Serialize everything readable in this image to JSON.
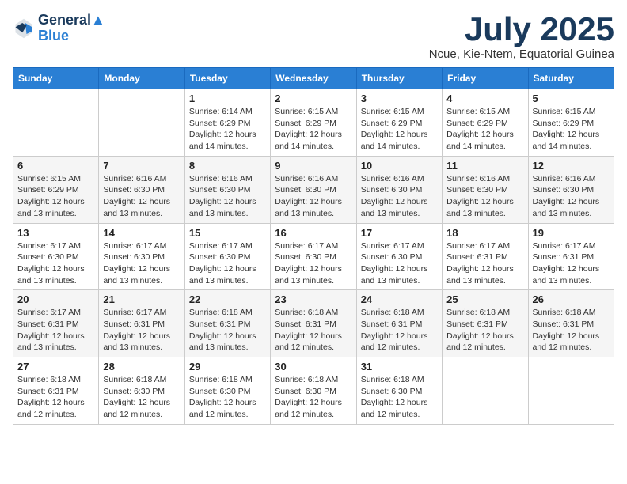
{
  "logo": {
    "line1": "General",
    "line2": "Blue"
  },
  "header": {
    "month": "July 2025",
    "location": "Ncue, Kie-Ntem, Equatorial Guinea"
  },
  "weekdays": [
    "Sunday",
    "Monday",
    "Tuesday",
    "Wednesday",
    "Thursday",
    "Friday",
    "Saturday"
  ],
  "weeks": [
    [
      {
        "day": "",
        "info": ""
      },
      {
        "day": "",
        "info": ""
      },
      {
        "day": "1",
        "info": "Sunrise: 6:14 AM\nSunset: 6:29 PM\nDaylight: 12 hours\nand 14 minutes."
      },
      {
        "day": "2",
        "info": "Sunrise: 6:15 AM\nSunset: 6:29 PM\nDaylight: 12 hours\nand 14 minutes."
      },
      {
        "day": "3",
        "info": "Sunrise: 6:15 AM\nSunset: 6:29 PM\nDaylight: 12 hours\nand 14 minutes."
      },
      {
        "day": "4",
        "info": "Sunrise: 6:15 AM\nSunset: 6:29 PM\nDaylight: 12 hours\nand 14 minutes."
      },
      {
        "day": "5",
        "info": "Sunrise: 6:15 AM\nSunset: 6:29 PM\nDaylight: 12 hours\nand 14 minutes."
      }
    ],
    [
      {
        "day": "6",
        "info": "Sunrise: 6:15 AM\nSunset: 6:29 PM\nDaylight: 12 hours\nand 13 minutes."
      },
      {
        "day": "7",
        "info": "Sunrise: 6:16 AM\nSunset: 6:30 PM\nDaylight: 12 hours\nand 13 minutes."
      },
      {
        "day": "8",
        "info": "Sunrise: 6:16 AM\nSunset: 6:30 PM\nDaylight: 12 hours\nand 13 minutes."
      },
      {
        "day": "9",
        "info": "Sunrise: 6:16 AM\nSunset: 6:30 PM\nDaylight: 12 hours\nand 13 minutes."
      },
      {
        "day": "10",
        "info": "Sunrise: 6:16 AM\nSunset: 6:30 PM\nDaylight: 12 hours\nand 13 minutes."
      },
      {
        "day": "11",
        "info": "Sunrise: 6:16 AM\nSunset: 6:30 PM\nDaylight: 12 hours\nand 13 minutes."
      },
      {
        "day": "12",
        "info": "Sunrise: 6:16 AM\nSunset: 6:30 PM\nDaylight: 12 hours\nand 13 minutes."
      }
    ],
    [
      {
        "day": "13",
        "info": "Sunrise: 6:17 AM\nSunset: 6:30 PM\nDaylight: 12 hours\nand 13 minutes."
      },
      {
        "day": "14",
        "info": "Sunrise: 6:17 AM\nSunset: 6:30 PM\nDaylight: 12 hours\nand 13 minutes."
      },
      {
        "day": "15",
        "info": "Sunrise: 6:17 AM\nSunset: 6:30 PM\nDaylight: 12 hours\nand 13 minutes."
      },
      {
        "day": "16",
        "info": "Sunrise: 6:17 AM\nSunset: 6:30 PM\nDaylight: 12 hours\nand 13 minutes."
      },
      {
        "day": "17",
        "info": "Sunrise: 6:17 AM\nSunset: 6:30 PM\nDaylight: 12 hours\nand 13 minutes."
      },
      {
        "day": "18",
        "info": "Sunrise: 6:17 AM\nSunset: 6:31 PM\nDaylight: 12 hours\nand 13 minutes."
      },
      {
        "day": "19",
        "info": "Sunrise: 6:17 AM\nSunset: 6:31 PM\nDaylight: 12 hours\nand 13 minutes."
      }
    ],
    [
      {
        "day": "20",
        "info": "Sunrise: 6:17 AM\nSunset: 6:31 PM\nDaylight: 12 hours\nand 13 minutes."
      },
      {
        "day": "21",
        "info": "Sunrise: 6:17 AM\nSunset: 6:31 PM\nDaylight: 12 hours\nand 13 minutes."
      },
      {
        "day": "22",
        "info": "Sunrise: 6:18 AM\nSunset: 6:31 PM\nDaylight: 12 hours\nand 13 minutes."
      },
      {
        "day": "23",
        "info": "Sunrise: 6:18 AM\nSunset: 6:31 PM\nDaylight: 12 hours\nand 12 minutes."
      },
      {
        "day": "24",
        "info": "Sunrise: 6:18 AM\nSunset: 6:31 PM\nDaylight: 12 hours\nand 12 minutes."
      },
      {
        "day": "25",
        "info": "Sunrise: 6:18 AM\nSunset: 6:31 PM\nDaylight: 12 hours\nand 12 minutes."
      },
      {
        "day": "26",
        "info": "Sunrise: 6:18 AM\nSunset: 6:31 PM\nDaylight: 12 hours\nand 12 minutes."
      }
    ],
    [
      {
        "day": "27",
        "info": "Sunrise: 6:18 AM\nSunset: 6:31 PM\nDaylight: 12 hours\nand 12 minutes."
      },
      {
        "day": "28",
        "info": "Sunrise: 6:18 AM\nSunset: 6:30 PM\nDaylight: 12 hours\nand 12 minutes."
      },
      {
        "day": "29",
        "info": "Sunrise: 6:18 AM\nSunset: 6:30 PM\nDaylight: 12 hours\nand 12 minutes."
      },
      {
        "day": "30",
        "info": "Sunrise: 6:18 AM\nSunset: 6:30 PM\nDaylight: 12 hours\nand 12 minutes."
      },
      {
        "day": "31",
        "info": "Sunrise: 6:18 AM\nSunset: 6:30 PM\nDaylight: 12 hours\nand 12 minutes."
      },
      {
        "day": "",
        "info": ""
      },
      {
        "day": "",
        "info": ""
      }
    ]
  ]
}
